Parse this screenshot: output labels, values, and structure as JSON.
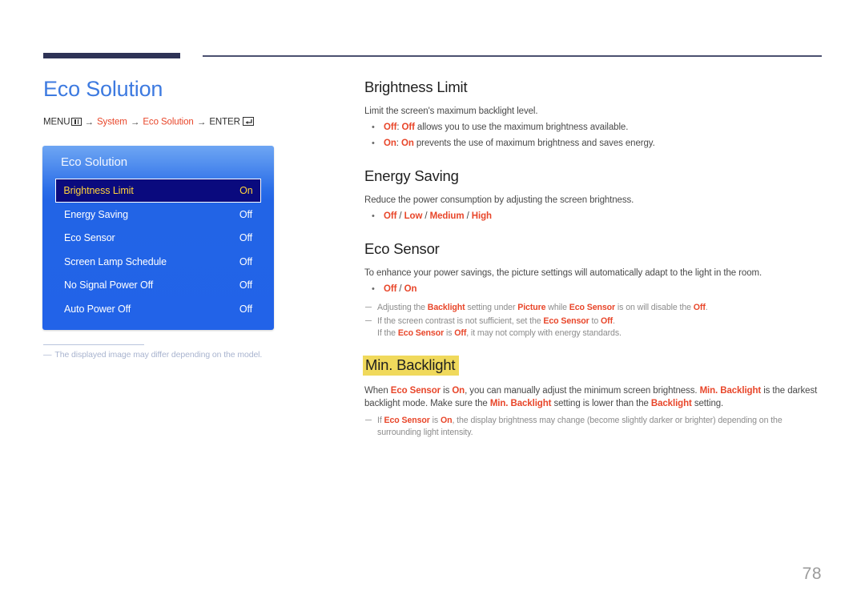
{
  "page": {
    "number": "78"
  },
  "left": {
    "title": "Eco Solution",
    "breadcrumb": {
      "menu_label": "MENU",
      "menu_icon": "menu-bars-icon",
      "arrow": "→",
      "item1": "System",
      "item2": "Eco Solution",
      "enter_label": "ENTER",
      "enter_icon": "enter-key-icon"
    },
    "osd": {
      "header": "Eco Solution",
      "rows": [
        {
          "label": "Brightness Limit",
          "value": "On",
          "selected": true
        },
        {
          "label": "Energy Saving",
          "value": "Off",
          "selected": false
        },
        {
          "label": "Eco Sensor",
          "value": "Off",
          "selected": false
        },
        {
          "label": "Screen Lamp Schedule",
          "value": "Off",
          "selected": false
        },
        {
          "label": "No Signal Power Off",
          "value": "Off",
          "selected": false
        },
        {
          "label": "Auto Power Off",
          "value": "Off",
          "selected": false
        }
      ]
    },
    "footnote": {
      "dash": "―",
      "text": "The displayed image may differ depending on the model."
    }
  },
  "right": {
    "sections": [
      {
        "id": "brightness-limit",
        "title": "Brightness Limit",
        "highlighted": false,
        "intro": "Limit the screen's maximum backlight level.",
        "bullets": [
          {
            "prefix": "Off",
            "sep": ": ",
            "mid": "Off",
            "rest": " allows you to use the maximum brightness available."
          },
          {
            "prefix": "On",
            "sep": ": ",
            "mid": "On",
            "rest": " prevents the use of maximum brightness and saves energy."
          }
        ]
      },
      {
        "id": "energy-saving",
        "title": "Energy Saving",
        "highlighted": false,
        "intro": "Reduce the power consumption by adjusting the screen brightness.",
        "options": [
          "Off",
          "Low",
          "Medium",
          "High"
        ],
        "option_sep": " / "
      },
      {
        "id": "eco-sensor",
        "title": "Eco Sensor",
        "highlighted": false,
        "intro": "To enhance your power savings, the picture settings will automatically adapt to the light in the room.",
        "options": [
          "Off",
          "On"
        ],
        "option_sep": " / ",
        "notes": [
          "Adjusting the Backlight setting under Picture while Eco Sensor is on will disable the Off.",
          "If the screen contrast is not sufficient, set the Eco Sensor to Off.",
          "If the Eco Sensor is Off, it may not comply with energy standards."
        ]
      },
      {
        "id": "min-backlight",
        "title": "Min. Backlight",
        "highlighted": true,
        "intro": "When Eco Sensor is On, you can manually adjust the minimum screen brightness. Min. Backlight is the darkest backlight mode. Make sure the Min. Backlight setting is lower than the Backlight setting.",
        "notes": [
          "If Eco Sensor is On, the display brightness may change (become slightly darker or brighter) depending on the",
          "surrounding light intensity."
        ]
      }
    ]
  },
  "colors": {
    "title_blue": "#3d7ae0",
    "accent_orange": "#e8462a",
    "rule_navy": "#2e3356",
    "osd_blue": "#2264e6",
    "osd_selected_bg": "#0a0a7e",
    "osd_selected_text": "#ffd33a",
    "highlight_yellow": "#f0d95c",
    "page_number_gray": "#9b9b9b"
  }
}
